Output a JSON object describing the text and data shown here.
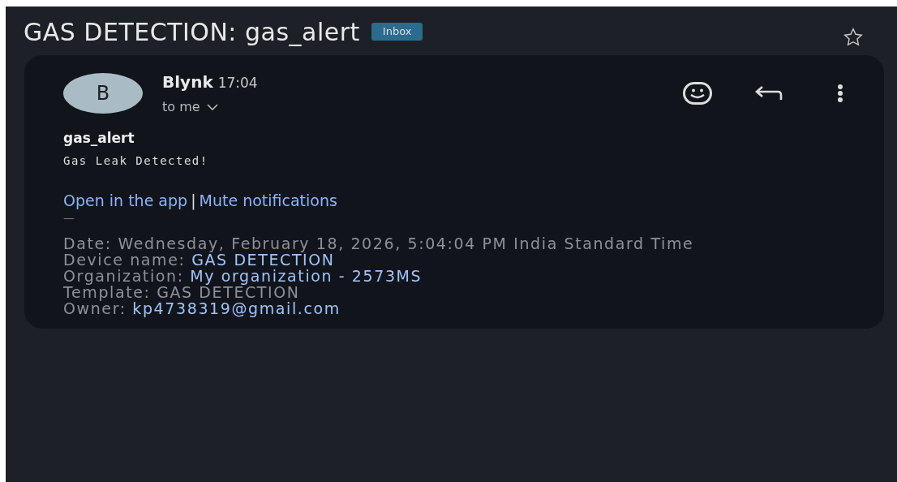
{
  "subject": "GAS DETECTION: gas_alert",
  "label": "Inbox",
  "starred": false,
  "message": {
    "avatar": "B",
    "sender": "Blynk",
    "time": "17:04",
    "recipient": "to me",
    "title": "gas_alert",
    "body": "Gas Leak Detected!",
    "links": [
      "Open in the app",
      "Mute notifications"
    ],
    "separator": "|",
    "signature_dash": "—",
    "details": [
      {
        "label": "Date:",
        "value": "Wednesday, February 18, 2026, 5:04:04 PM India Standard Time",
        "linked": false
      },
      {
        "label": "Device name:",
        "value": "GAS DETECTION",
        "linked": true
      },
      {
        "label": "Organization:",
        "value": "My organization - 2573MS",
        "linked": true
      },
      {
        "label": "Template:",
        "value": "GAS DETECTION",
        "linked": false
      },
      {
        "label": "Owner:",
        "value": "kp4738319@gmail.com",
        "linked": true
      }
    ]
  }
}
